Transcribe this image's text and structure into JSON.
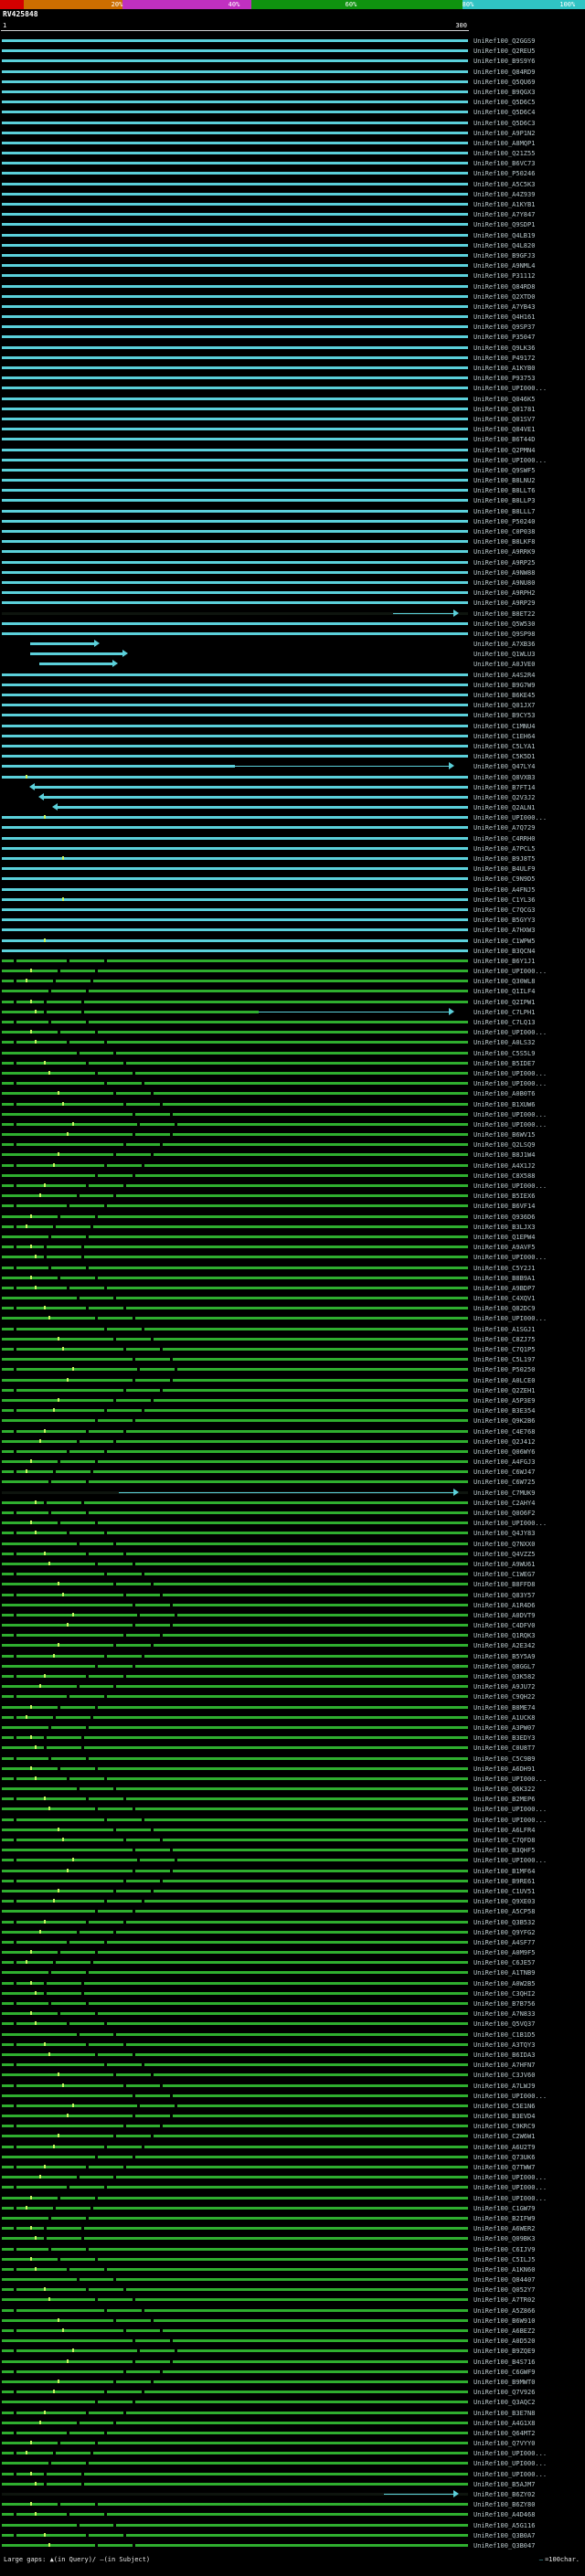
{
  "key": {
    "labels": [
      "20%",
      "40%",
      "60%",
      "80%",
      "100%"
    ],
    "label_positions": [
      20,
      40,
      60,
      80,
      97
    ],
    "segments": [
      {
        "color": "#d40000",
        "width": 4
      },
      {
        "color": "#cc6e00",
        "width": 17
      },
      {
        "color": "#c030c0",
        "width": 22
      },
      {
        "color": "#0f930f",
        "width": 36
      },
      {
        "color": "#30c4c4",
        "width": 21
      }
    ]
  },
  "query": {
    "name": "RV425848",
    "ruler_start": "1",
    "ruler_end": "300"
  },
  "legend": {
    "gaps": "Large gaps: ▲(in Query)/ —(in Subject)",
    "scale_dash": "—",
    "scale_text": "=100char."
  },
  "colors": {
    "cyan": "#5bd0da",
    "green": "#2fae2f",
    "black_bar": "#0e140e",
    "dot": "#c8f55f",
    "background": "#000000",
    "text": "#ffffff",
    "label": "#b8c7cb"
  },
  "chart_data": {
    "type": "bar",
    "title": "RV425848",
    "x_range": [
      1,
      300
    ],
    "orientation": "horizontal",
    "identity_colors": {
      "cyan": "80-100% identity",
      "green": "60-80% identity"
    },
    "cyan_count": 90,
    "dot_start_cyan": 70,
    "labels": [
      "UniRef100_Q2GGS9",
      "UniRef100_Q2REU5",
      "UniRef100_B9S9Y6",
      "UniRef100_Q84RD9",
      "UniRef100_Q5QU69",
      "UniRef100_B9QGX3",
      "UniRef100_Q5D6C5",
      "UniRef100_Q5D6C4",
      "UniRef100_Q5D6C3",
      "UniRef100_A9P1N2",
      "UniRef100_A8MQP1",
      "UniRef100_Q21Z55",
      "UniRef100_B6VC73",
      "UniRef100_P50246",
      "UniRef100_A5C5K3",
      "UniRef100_A4Z939",
      "UniRef100_A1KYB1",
      "UniRef100_A7Y847",
      "UniRef100_Q9SDP1",
      "UniRef100_Q4LB19",
      "UniRef100_Q4L820",
      "UniRef100_B9GFJ3",
      "UniRef100_A9NML4",
      "UniRef100_P31112",
      "UniRef100_Q84RD8",
      "UniRef100_Q2XTD0",
      "UniRef100_A7YB43",
      "UniRef100_Q4H161",
      "UniRef100_Q9SP37",
      "UniRef100_P35047",
      "UniRef100_Q9LK36",
      "UniRef100_P49172",
      "UniRef100_A1KYB0",
      "UniRef100_P93753",
      "UniRef100_UPI000...",
      "UniRef100_Q046K5",
      "UniRef100_Q01781",
      "UniRef100_Q01SV7",
      "UniRef100_Q84VE1",
      "UniRef100_B6T44D",
      "UniRef100_Q2PMN4",
      "UniRef100_UPI000...",
      "UniRef100_Q9SWF5",
      "UniRef100_B8LNU2",
      "UniRef100_B8LLT6",
      "UniRef100_B8LLP3",
      "UniRef100_B8LLL7",
      "UniRef100_P50240",
      "UniRef100_C0P038",
      "UniRef100_B8LKF8",
      "UniRef100_A9RRK9",
      "UniRef100_A9RP25",
      "UniRef100_A9NW88",
      "UniRef100_A9NU80",
      "UniRef100_A9RPH2",
      "UniRef100_A9RP29",
      "UniRef100_B8ET22",
      "UniRef100_Q5W530",
      "UniRef100_Q9SP98",
      "UniRef100_A7XB36",
      "UniRef100_Q1WLU3",
      "UniRef100_A0JVE0",
      "UniRef100_A4S2R4",
      "UniRef100_B9G7W9",
      "UniRef100_B6KE45",
      "UniRef100_Q01JX7",
      "UniRef100_B9CY53",
      "UniRef100_C1MNU4",
      "UniRef100_C1EH64",
      "UniRef100_C5LYA1",
      "UniRef100_C5K5D1",
      "UniRef100_Q47LY4",
      "UniRef100_Q8VXB3",
      "UniRef100_B7FT14",
      "UniRef100_Q2V3J2",
      "UniRef100_Q2ALN1",
      "UniRef100_UPI000...",
      "UniRef100_A7Q729",
      "UniRef100_C4RRH0",
      "UniRef100_A7PCL5",
      "UniRef100_B9J8T5",
      "UniRef100_B4ULF9",
      "UniRef100_C9N9D5",
      "UniRef100_A4FNJ5",
      "UniRef100_C1YL36",
      "UniRef100_C7QCG3",
      "UniRef100_B5GYY3",
      "UniRef100_A7HXW3",
      "UniRef100_C1WPW5",
      "UniRef100_B3QCN4",
      "UniRef100_B6Y1J1",
      "UniRef100_UPI000...",
      "UniRef100_Q30WL8",
      "UniRef100_Q1ILF4",
      "UniRef100_Q2IPW1",
      "UniRef100_C7LPH1",
      "UniRef100_C7LQ13",
      "UniRef100_UPI000...",
      "UniRef100_A0LS32",
      "UniRef100_C5S5L9",
      "UniRef100_B5IDE7",
      "UniRef100_UPI000...",
      "UniRef100_UPI000...",
      "UniRef100_A0B0T6",
      "UniRef100_B1XUW6",
      "UniRef100_UPI000...",
      "UniRef100_UPI000...",
      "UniRef100_B6WV15",
      "UniRef100_Q2LSQ9",
      "UniRef100_B8J1W4",
      "UniRef100_A4X1J2",
      "UniRef100_C8X588",
      "UniRef100_UPI000...",
      "UniRef100_B5IEX6",
      "UniRef100_B6VF14",
      "UniRef100_Q936D6",
      "UniRef100_B3LJX3",
      "UniRef100_Q1EPW4",
      "UniRef100_A9AVF5",
      "UniRef100_UPI000...",
      "UniRef100_C5Y2J1",
      "UniRef100_B8B9A1",
      "UniRef100_A9BDP7",
      "UniRef100_C4XQV1",
      "UniRef100_Q82DC9",
      "UniRef100_UPI000...",
      "UniRef100_A1SGJ1",
      "UniRef100_C8ZJ75",
      "UniRef100_C7Q1P5",
      "UniRef100_C5L197",
      "UniRef100_P50250",
      "UniRef100_A0LCE0",
      "UniRef100_Q2ZEH1",
      "UniRef100_A5P3E9",
      "UniRef100_B3E354",
      "UniRef100_Q9K2B6",
      "UniRef100_C4E768",
      "UniRef100_Q2J412",
      "UniRef100_Q06WY6",
      "UniRef100_A4FGJ3",
      "UniRef100_C6WJ47",
      "UniRef100_C6W725",
      "UniRef100_C7MUK9",
      "UniRef100_C2AHY4",
      "UniRef100_Q0O6F2",
      "UniRef100_UPI000...",
      "UniRef100_Q4JY83",
      "UniRef100_Q7NXX0",
      "UniRef100_Q4VZZ5",
      "UniRef100_A9WU61",
      "UniRef100_C1WEG7",
      "UniRef100_B8FFD8",
      "UniRef100_Q83Y57",
      "UniRef100_A1R4D6",
      "UniRef100_A0DVT9",
      "UniRef100_C4DFV0",
      "UniRef100_Q1RQK3",
      "UniRef100_A2E342",
      "UniRef100_B5Y5A9",
      "UniRef100_Q8GGL7",
      "UniRef100_Q3K582",
      "UniRef100_A9JU72",
      "UniRef100_C9QH22",
      "UniRef100_B8ME74",
      "UniRef100_A1UCK8",
      "UniRef100_A3PW07",
      "UniRef100_B3EDY3",
      "UniRef100_C0U8T7",
      "UniRef100_C5C9B9",
      "UniRef100_A6DH91",
      "UniRef100_UPI000...",
      "UniRef100_Q6K322",
      "UniRef100_B2MEP6",
      "UniRef100_UPI000...",
      "UniRef100_UPI000...",
      "UniRef100_A6LFR4",
      "UniRef100_C7QFD8",
      "UniRef100_B3QHF5",
      "UniRef100_UPI000...",
      "UniRef100_B1MF64",
      "UniRef100_B9RE61",
      "UniRef100_C1UV51",
      "UniRef100_Q9XE03",
      "UniRef100_A5CP58",
      "UniRef100_Q3B532",
      "UniRef100_Q9YFG2",
      "UniRef100_A4SF77",
      "UniRef100_A0M9F5",
      "UniRef100_C6JE57",
      "UniRef100_A1TNB9",
      "UniRef100_A0W2B5",
      "UniRef100_C3QHI2",
      "UniRef100_B7B756",
      "UniRef100_A7N833",
      "UniRef100_Q5VQ37",
      "UniRef100_C1B1D5",
      "UniRef100_A3TQY3",
      "UniRef100_B6IDA3",
      "UniRef100_A7HFN7",
      "UniRef100_C3JV60",
      "UniRef100_A7LWJ9",
      "UniRef100_UPI000...",
      "UniRef100_C5E1N6",
      "UniRef100_B3EVD4",
      "UniRef100_C9KRC9",
      "UniRef100_C2W6W1",
      "UniRef100_A6U2T9",
      "UniRef100_Q73UK6",
      "UniRef100_Q7TWW7",
      "UniRef100_UPI000...",
      "UniRef100_UPI000...",
      "UniRef100_UPI000...",
      "UniRef100_C1GW79",
      "UniRef100_B2IFW9",
      "UniRef100_A6WER2",
      "UniRef100_Q09BK3",
      "UniRef100_C6IJV9",
      "UniRef100_C5ILJ5",
      "UniRef100_A1KN60",
      "UniRef100_Q84407",
      "UniRef100_Q052Y7",
      "UniRef100_A7TR02",
      "UniRef100_A5Z866",
      "UniRef100_B6W910",
      "UniRef100_A6BEZ2",
      "UniRef100_A0D520",
      "UniRef100_B9ZQE9",
      "UniRef100_B4S716",
      "UniRef100_C6GWF9",
      "UniRef100_B9MWT0",
      "UniRef100_Q7V926",
      "UniRef100_Q3AQC2",
      "UniRef100_B3E7N8",
      "UniRef100_A4G1X8",
      "UniRef100_Q64MT2",
      "UniRef100_Q7VYY0",
      "UniRef100_UPI000...",
      "UniRef100_UPI000...",
      "UniRef100_UPI000...",
      "UniRef100_B5AJM7",
      "UniRef100_B6ZY02",
      "UniRef100_B6ZY80",
      "UniRef100_A4D468",
      "UniRef100_A5G116",
      "UniRef100_Q3B0A7",
      "UniRef100_Q3B047"
    ],
    "specials": {
      "56": {
        "c": "k",
        "ext": {
          "s": 84,
          "e": 97
        }
      },
      "59": {
        "c": "c",
        "s": 6,
        "e": 20,
        "a": "r"
      },
      "60": {
        "c": "c",
        "s": 6,
        "e": 26,
        "a": "r"
      },
      "61": {
        "c": "c",
        "s": 8,
        "e": 24,
        "a": "r"
      },
      "71": {
        "c": "c",
        "e": 50,
        "ext": {
          "s": 50,
          "e": 96
        }
      },
      "73": {
        "c": "c",
        "s": 7,
        "a": "l"
      },
      "74": {
        "c": "c",
        "s": 9,
        "a": "l"
      },
      "75": {
        "c": "c",
        "s": 12,
        "a": "l"
      },
      "95": {
        "c": "g",
        "e": 55,
        "ext": {
          "s": 55,
          "e": 96
        }
      },
      "142": {
        "c": "k",
        "ext": {
          "s": 25,
          "e": 97
        }
      },
      "240": {
        "c": "k",
        "ext": {
          "s": 82,
          "e": 97
        }
      }
    },
    "texture": {
      "dark_cycle": [
        10,
        12,
        14,
        16,
        18,
        20,
        22,
        24,
        26,
        28,
        29,
        28,
        26,
        24,
        22,
        20,
        18,
        16,
        14,
        12,
        11,
        10,
        9,
        9
      ],
      "dark_offset": 8,
      "edge_dark": 2.5,
      "dot_cycle": [
        5,
        6,
        7,
        8,
        9,
        10,
        11,
        12,
        13,
        14,
        15,
        14,
        13,
        12,
        11,
        10,
        9,
        8,
        7,
        6,
        5,
        5,
        6,
        7
      ]
    }
  }
}
